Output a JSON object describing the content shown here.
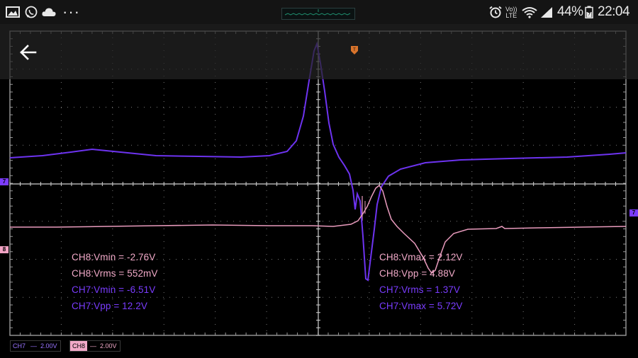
{
  "status_bar": {
    "icons": [
      "image-icon",
      "whatsapp-icon",
      "cloud-icon",
      "overflow-dots-icon",
      "alarm-icon",
      "volte-icon",
      "wifi-icon",
      "signal-icon",
      "battery-icon"
    ],
    "volte_line1": "Vo))",
    "volte_line2": "LTE",
    "battery_percent": "44%",
    "time": "22:04"
  },
  "app_bar": {
    "back_icon": "arrow-left-icon"
  },
  "scope": {
    "trigger_icon": "trigger-position-marker",
    "channel_markers": {
      "ch7": "7",
      "ch8": "8"
    },
    "measurements_left": [
      {
        "text": "CH8:Vmin = -2.76V",
        "channel": "CH8"
      },
      {
        "text": "CH8:Vrms = 552mV",
        "channel": "CH8"
      },
      {
        "text": "CH7:Vmin = -6.51V",
        "channel": "CH7"
      },
      {
        "text": "CH7:Vpp = 12.2V",
        "channel": "CH7"
      }
    ],
    "measurements_right": [
      {
        "text": "CH8:Vmax = 2.12V",
        "channel": "CH8"
      },
      {
        "text": "CH8:Vpp = 4.88V",
        "channel": "CH8"
      },
      {
        "text": "CH7:Vrms = 1.37V",
        "channel": "CH7"
      },
      {
        "text": "CH7:Vmax = 5.72V",
        "channel": "CH7"
      }
    ],
    "scales": {
      "ch7": {
        "tag": "CH7",
        "coupling": "—",
        "volts_per_div": "2.00V"
      },
      "ch8": {
        "tag": "CH8",
        "coupling": "—",
        "volts_per_div": "2.00V"
      }
    },
    "colors": {
      "ch7": "#7a3cff",
      "ch8": "#f1a9c8",
      "grid": "#8a8a8a",
      "axis": "#d0d0d0"
    }
  }
}
